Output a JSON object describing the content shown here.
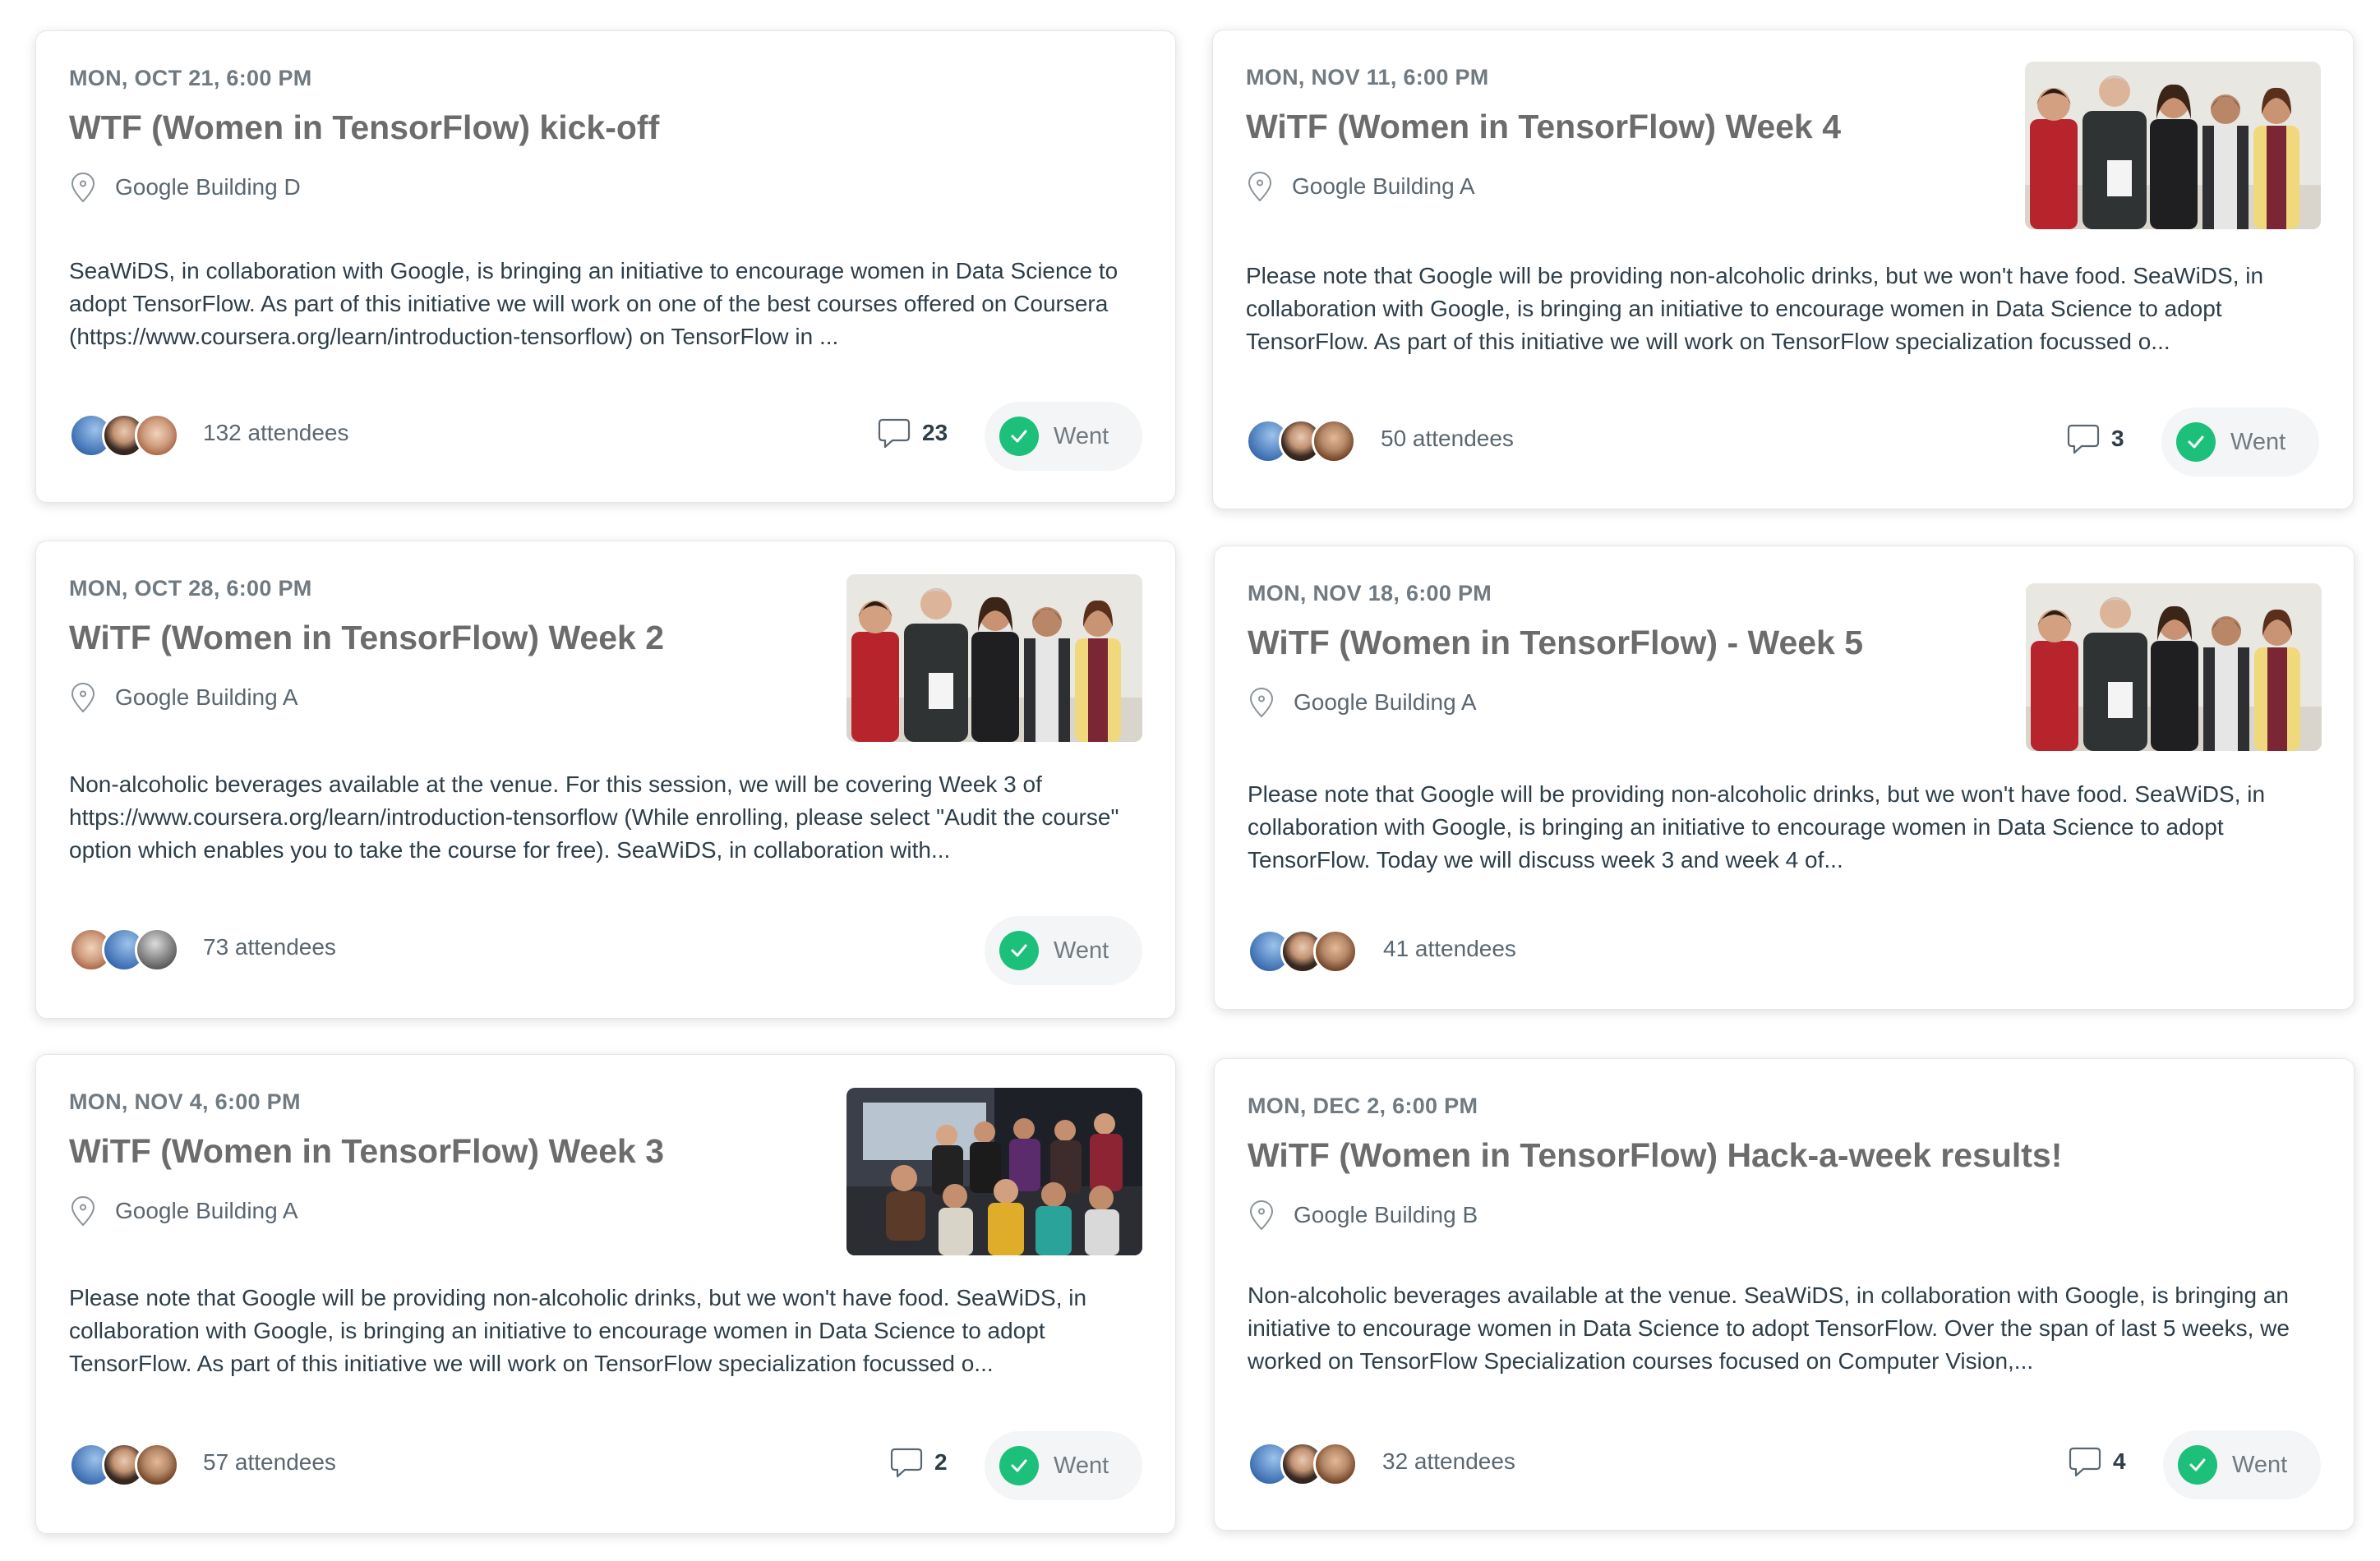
{
  "events": [
    {
      "date": "MON, OCT 21, 6:00 PM",
      "title": "WTF (Women in TensorFlow) kick-off",
      "location": "Google Building D",
      "description": "SeaWiDS, in collaboration with Google, is bringing an initiative to encourage women in Data Science to adopt TensorFlow. As part of this initiative we will work on one of the best courses offered on Coursera (https://www.coursera.org/learn/introduction-tensorflow) on TensorFlow in ...",
      "attendees": "132 attendees",
      "comments": "23",
      "rsvp": "Went"
    },
    {
      "date": "MON, NOV 11, 6:00 PM",
      "title": "WiTF (Women in TensorFlow) Week 4",
      "location": "Google Building A",
      "description": "Please note that Google will be providing non-alcoholic drinks, but we won't have food. SeaWiDS, in collaboration with Google, is bringing an initiative to encourage women in Data Science to adopt TensorFlow. As part of this initiative we will work on TensorFlow specialization focussed o...",
      "attendees": "50 attendees",
      "comments": "3",
      "rsvp": "Went"
    },
    {
      "date": "MON, OCT 28, 6:00 PM",
      "title": "WiTF (Women in TensorFlow) Week 2",
      "location": "Google Building A",
      "description": "Non-alcoholic beverages available at the venue. For this session, we will be covering Week 3 of https://www.coursera.org/learn/introduction-tensorflow (While enrolling, please select \"Audit the course\" option which enables you to take the course for free). SeaWiDS, in collaboration with...",
      "attendees": "73 attendees",
      "rsvp": "Went"
    },
    {
      "date": "MON, NOV 18, 6:00 PM",
      "title": "WiTF (Women in TensorFlow) - Week 5",
      "location": "Google Building A",
      "description": "Please note that Google will be providing non-alcoholic drinks, but we won't have food. SeaWiDS, in collaboration with Google, is bringing an initiative to encourage women in Data Science to adopt TensorFlow. Today we will discuss week 3 and week 4 of...",
      "attendees": "41 attendees"
    },
    {
      "date": "MON, NOV 4, 6:00 PM",
      "title": "WiTF (Women in TensorFlow) Week 3",
      "location": "Google Building A",
      "description": "Please note that Google will be providing non-alcoholic drinks, but we won't have food. SeaWiDS, in collaboration with Google, is bringing an initiative to encourage women in Data Science to adopt TensorFlow. As part of this initiative we will work on TensorFlow specialization focussed o...",
      "attendees": "57 attendees",
      "comments": "2",
      "rsvp": "Went"
    },
    {
      "date": "MON, DEC 2, 6:00 PM",
      "title": "WiTF (Women in TensorFlow) Hack-a-week results!",
      "location": "Google Building B",
      "description": "Non-alcoholic beverages available at the venue. SeaWiDS, in collaboration with Google, is bringing an initiative to encourage women in Data Science to adopt TensorFlow. Over the span of last 5 weeks, we worked on TensorFlow Specialization courses focused on Computer Vision,...",
      "attendees": "32 attendees",
      "comments": "4",
      "rsvp": "Went"
    }
  ],
  "icons": {
    "location": "map-pin-icon",
    "comment": "speech-bubble-icon",
    "went": "checkmark-icon"
  },
  "colors": {
    "went_check": "#1dc07a",
    "title": "#6c6c6c",
    "date": "#707a80"
  }
}
